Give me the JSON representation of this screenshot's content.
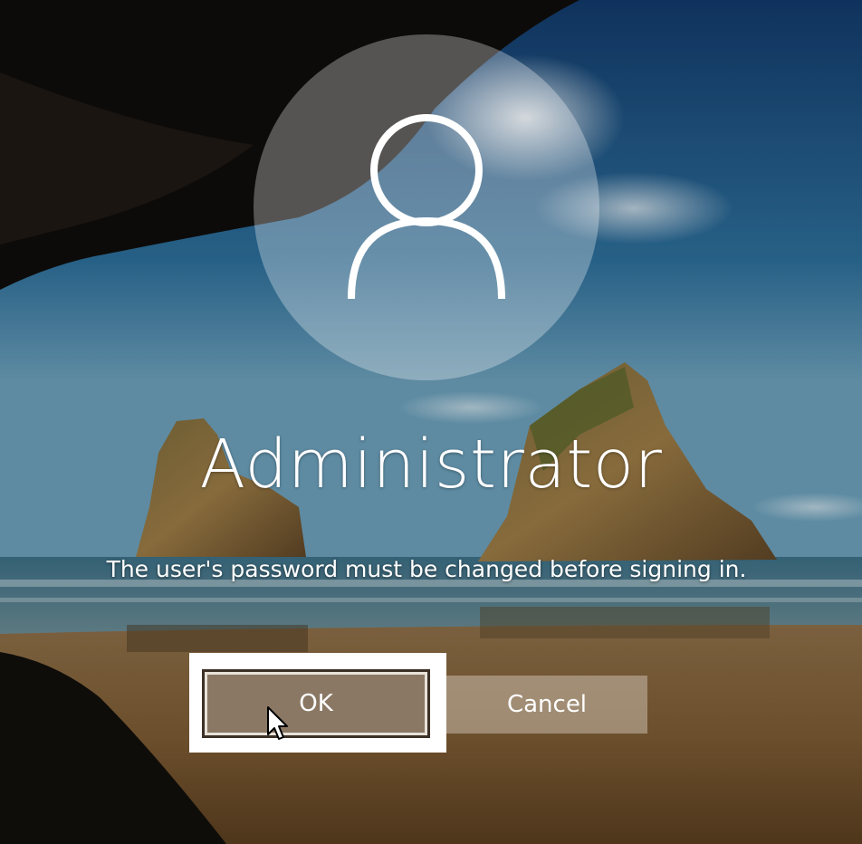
{
  "user": {
    "name": "Administrator"
  },
  "message": "The user's password must be changed before signing in.",
  "buttons": {
    "ok_label": "OK",
    "cancel_label": "Cancel"
  },
  "colors": {
    "ok_button": "#8a7864",
    "focus_outline": "#ffffff",
    "text": "#ffffff"
  },
  "icons": {
    "avatar": "user-silhouette-icon",
    "cursor": "mouse-pointer-icon"
  }
}
